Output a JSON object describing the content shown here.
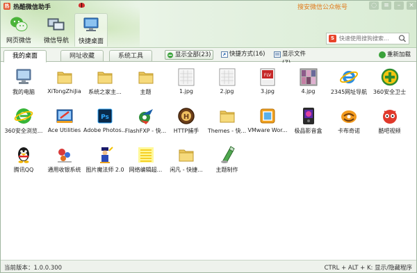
{
  "window": {
    "title": "热酷微信助手",
    "follow_link": "搜安微信公众帐号"
  },
  "nav": [
    {
      "label": "网页微信",
      "icon": "wechat-icon"
    },
    {
      "label": "微信导航",
      "icon": "monitors-icon"
    },
    {
      "label": "快捷桌面",
      "icon": "desktop-icon"
    }
  ],
  "search": {
    "placeholder": "快速使用搜狗搜索..."
  },
  "tabs": [
    {
      "label": "我的桌面",
      "active": true
    },
    {
      "label": "网址收藏",
      "active": false
    },
    {
      "label": "系统工具",
      "active": false
    }
  ],
  "filters": {
    "all": "显示全部(23)",
    "shortcut": "快捷方式(16)",
    "file": "显示文件(7)",
    "reload": "重新加载"
  },
  "items": [
    {
      "name": "我的电脑",
      "icon": "computer-icon"
    },
    {
      "name": "XiTongZhiJia",
      "icon": "folder-icon"
    },
    {
      "name": "系统之家主...",
      "icon": "folder-icon"
    },
    {
      "name": "主题",
      "icon": "folder-icon"
    },
    {
      "name": "1.jpg",
      "icon": "image-file-icon"
    },
    {
      "name": "2.jpg",
      "icon": "image-file-icon"
    },
    {
      "name": "3.jpg",
      "icon": "flv-image-icon"
    },
    {
      "name": "4.jpg",
      "icon": "photo-thumb-icon"
    },
    {
      "name": "2345网址导航",
      "icon": "ie-browser-icon"
    },
    {
      "name": "360安全卫士",
      "icon": "360-guard-icon"
    },
    {
      "name": "360安全浏览...",
      "icon": "360-browser-icon"
    },
    {
      "name": "Ace Utilities",
      "icon": "ace-utilities-icon"
    },
    {
      "name": "Adobe Photos...",
      "icon": "photoshop-icon"
    },
    {
      "name": "FlashFXP - 快...",
      "icon": "flashfxp-icon"
    },
    {
      "name": "HTTP捕手",
      "icon": "http-catcher-icon"
    },
    {
      "name": "Themes - 快...",
      "icon": "folder-icon"
    },
    {
      "name": "VMware Wor...",
      "icon": "vmware-icon"
    },
    {
      "name": "极品影音盒",
      "icon": "media-box-icon"
    },
    {
      "name": "卡布奇诺",
      "icon": "cappuccino-icon"
    },
    {
      "name": "酷吧视频",
      "icon": "kuba-video-icon"
    },
    {
      "name": "腾讯QQ",
      "icon": "qq-penguin-icon"
    },
    {
      "name": "通用收银系统",
      "icon": "cashier-icon"
    },
    {
      "name": "图片魔法师 2.0",
      "icon": "photo-magician-icon"
    },
    {
      "name": "网络编辑超...",
      "icon": "notes-icon"
    },
    {
      "name": "闲凡 - 快捷...",
      "icon": "folder-icon"
    },
    {
      "name": "主题制作",
      "icon": "theme-maker-icon"
    }
  ],
  "status": {
    "version": "当前版本：1.0.0.300",
    "hotkey": "CTRL + ALT + K: 显示/隐藏程序"
  },
  "colors": {
    "accent_green": "#3aa23a",
    "title_orange": "#e07a1a",
    "border": "#aebfab"
  }
}
